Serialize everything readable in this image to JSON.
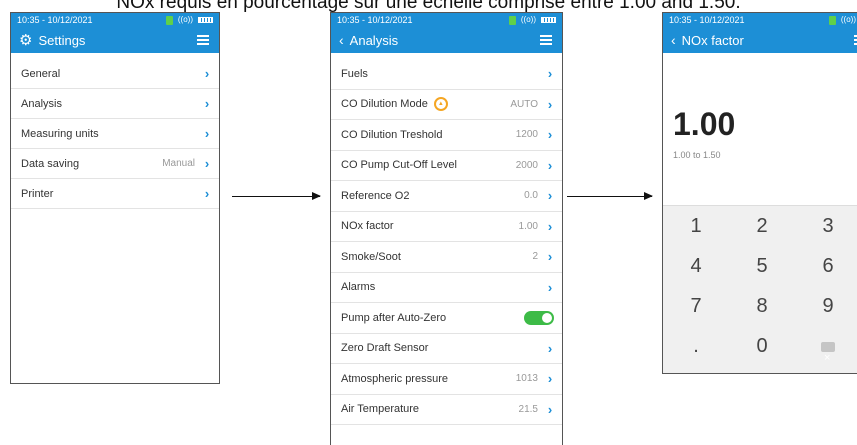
{
  "caption": "NOx requis en pourcentage sur une échelle comprise entre 1.00 and 1.50.",
  "status": {
    "time": "10:35 - 10/12/2021",
    "wifi": "((o))"
  },
  "settings": {
    "title": "Settings",
    "items": [
      {
        "label": "General",
        "value": ""
      },
      {
        "label": "Analysis",
        "value": ""
      },
      {
        "label": "Measuring units",
        "value": ""
      },
      {
        "label": "Data saving",
        "value": "Manual"
      },
      {
        "label": "Printer",
        "value": ""
      }
    ]
  },
  "analysis": {
    "title": "Analysis",
    "items": [
      {
        "label": "Fuels",
        "value": ""
      },
      {
        "label": "CO Dilution Mode",
        "value": "AUTO"
      },
      {
        "label": "CO Dilution Treshold",
        "value": "1200"
      },
      {
        "label": "CO Pump Cut-Off Level",
        "value": "2000"
      },
      {
        "label": "Reference O2",
        "value": "0.0"
      },
      {
        "label": "NOx factor",
        "value": "1.00"
      },
      {
        "label": "Smoke/Soot",
        "value": "2"
      },
      {
        "label": "Alarms",
        "value": ""
      },
      {
        "label": "Pump after Auto-Zero",
        "value": "",
        "toggle_on": true
      },
      {
        "label": "Zero Draft Sensor",
        "value": ""
      },
      {
        "label": "Atmospheric pressure",
        "value": "1013"
      },
      {
        "label": "Air Temperature",
        "value": "21.5"
      }
    ]
  },
  "nox": {
    "title": "NOx factor",
    "value": "1.00",
    "range": "1.00 to 1.50",
    "keys": [
      "1",
      "2",
      "3",
      "4",
      "5",
      "6",
      "7",
      "8",
      "9",
      ".",
      "0",
      "backspace"
    ]
  },
  "colors": {
    "accent": "#1d8fd6",
    "toggle": "#3dbb47",
    "warning": "#f5a623"
  },
  "icons": [
    "gear-icon",
    "menu-icon",
    "back-icon",
    "chevron-right-icon",
    "warning-icon",
    "battery-icon",
    "wifi-icon",
    "sim-icon",
    "backspace-icon"
  ]
}
